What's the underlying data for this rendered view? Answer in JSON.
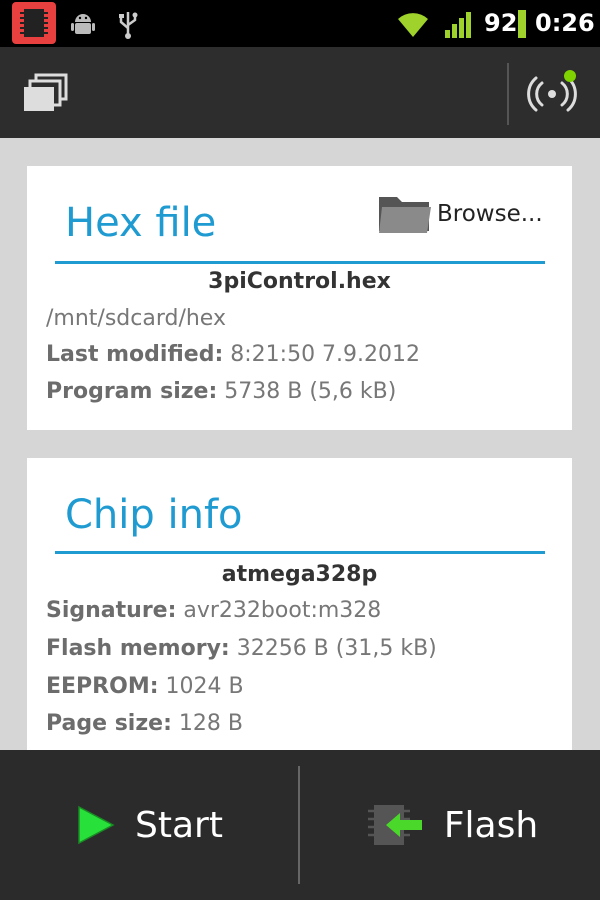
{
  "status_bar": {
    "battery_level": "92",
    "time": "0:26",
    "icons": [
      "chip-icon",
      "android-debug-icon",
      "usb-icon",
      "wifi-icon",
      "signal-icon",
      "battery-icon"
    ]
  },
  "action_bar": {
    "left_icon": "windows-stack-icon",
    "right_icon": "wireless-connection-icon",
    "connection_status_color": "#7fd300"
  },
  "hex_card": {
    "title": "Hex file",
    "browse_label": "Browse...",
    "file_name": "3piControl.hex",
    "path": "/mnt/sdcard/hex",
    "last_modified_label": "Last modified:",
    "last_modified_value": "8:21:50 7.9.2012",
    "program_size_label": "Program size:",
    "program_size_value": "5738 B (5,6 kB)"
  },
  "chip_card": {
    "title": "Chip info",
    "chip_name": "atmega328p",
    "signature_label": "Signature:",
    "signature_value": "avr232boot:m328",
    "flash_label": "Flash memory:",
    "flash_value": "32256 B (31,5 kB)",
    "eeprom_label": "EEPROM:",
    "eeprom_value": "1024 B",
    "page_size_label": "Page size:",
    "page_size_value": "128 B"
  },
  "bottom_bar": {
    "start_label": "Start",
    "flash_label": "Flash"
  },
  "colors": {
    "accent": "#1f9bd2",
    "start_icon": "#28e03a",
    "flash_arrow": "#4ad92a",
    "status_chip_bg": "#e83f3f"
  }
}
